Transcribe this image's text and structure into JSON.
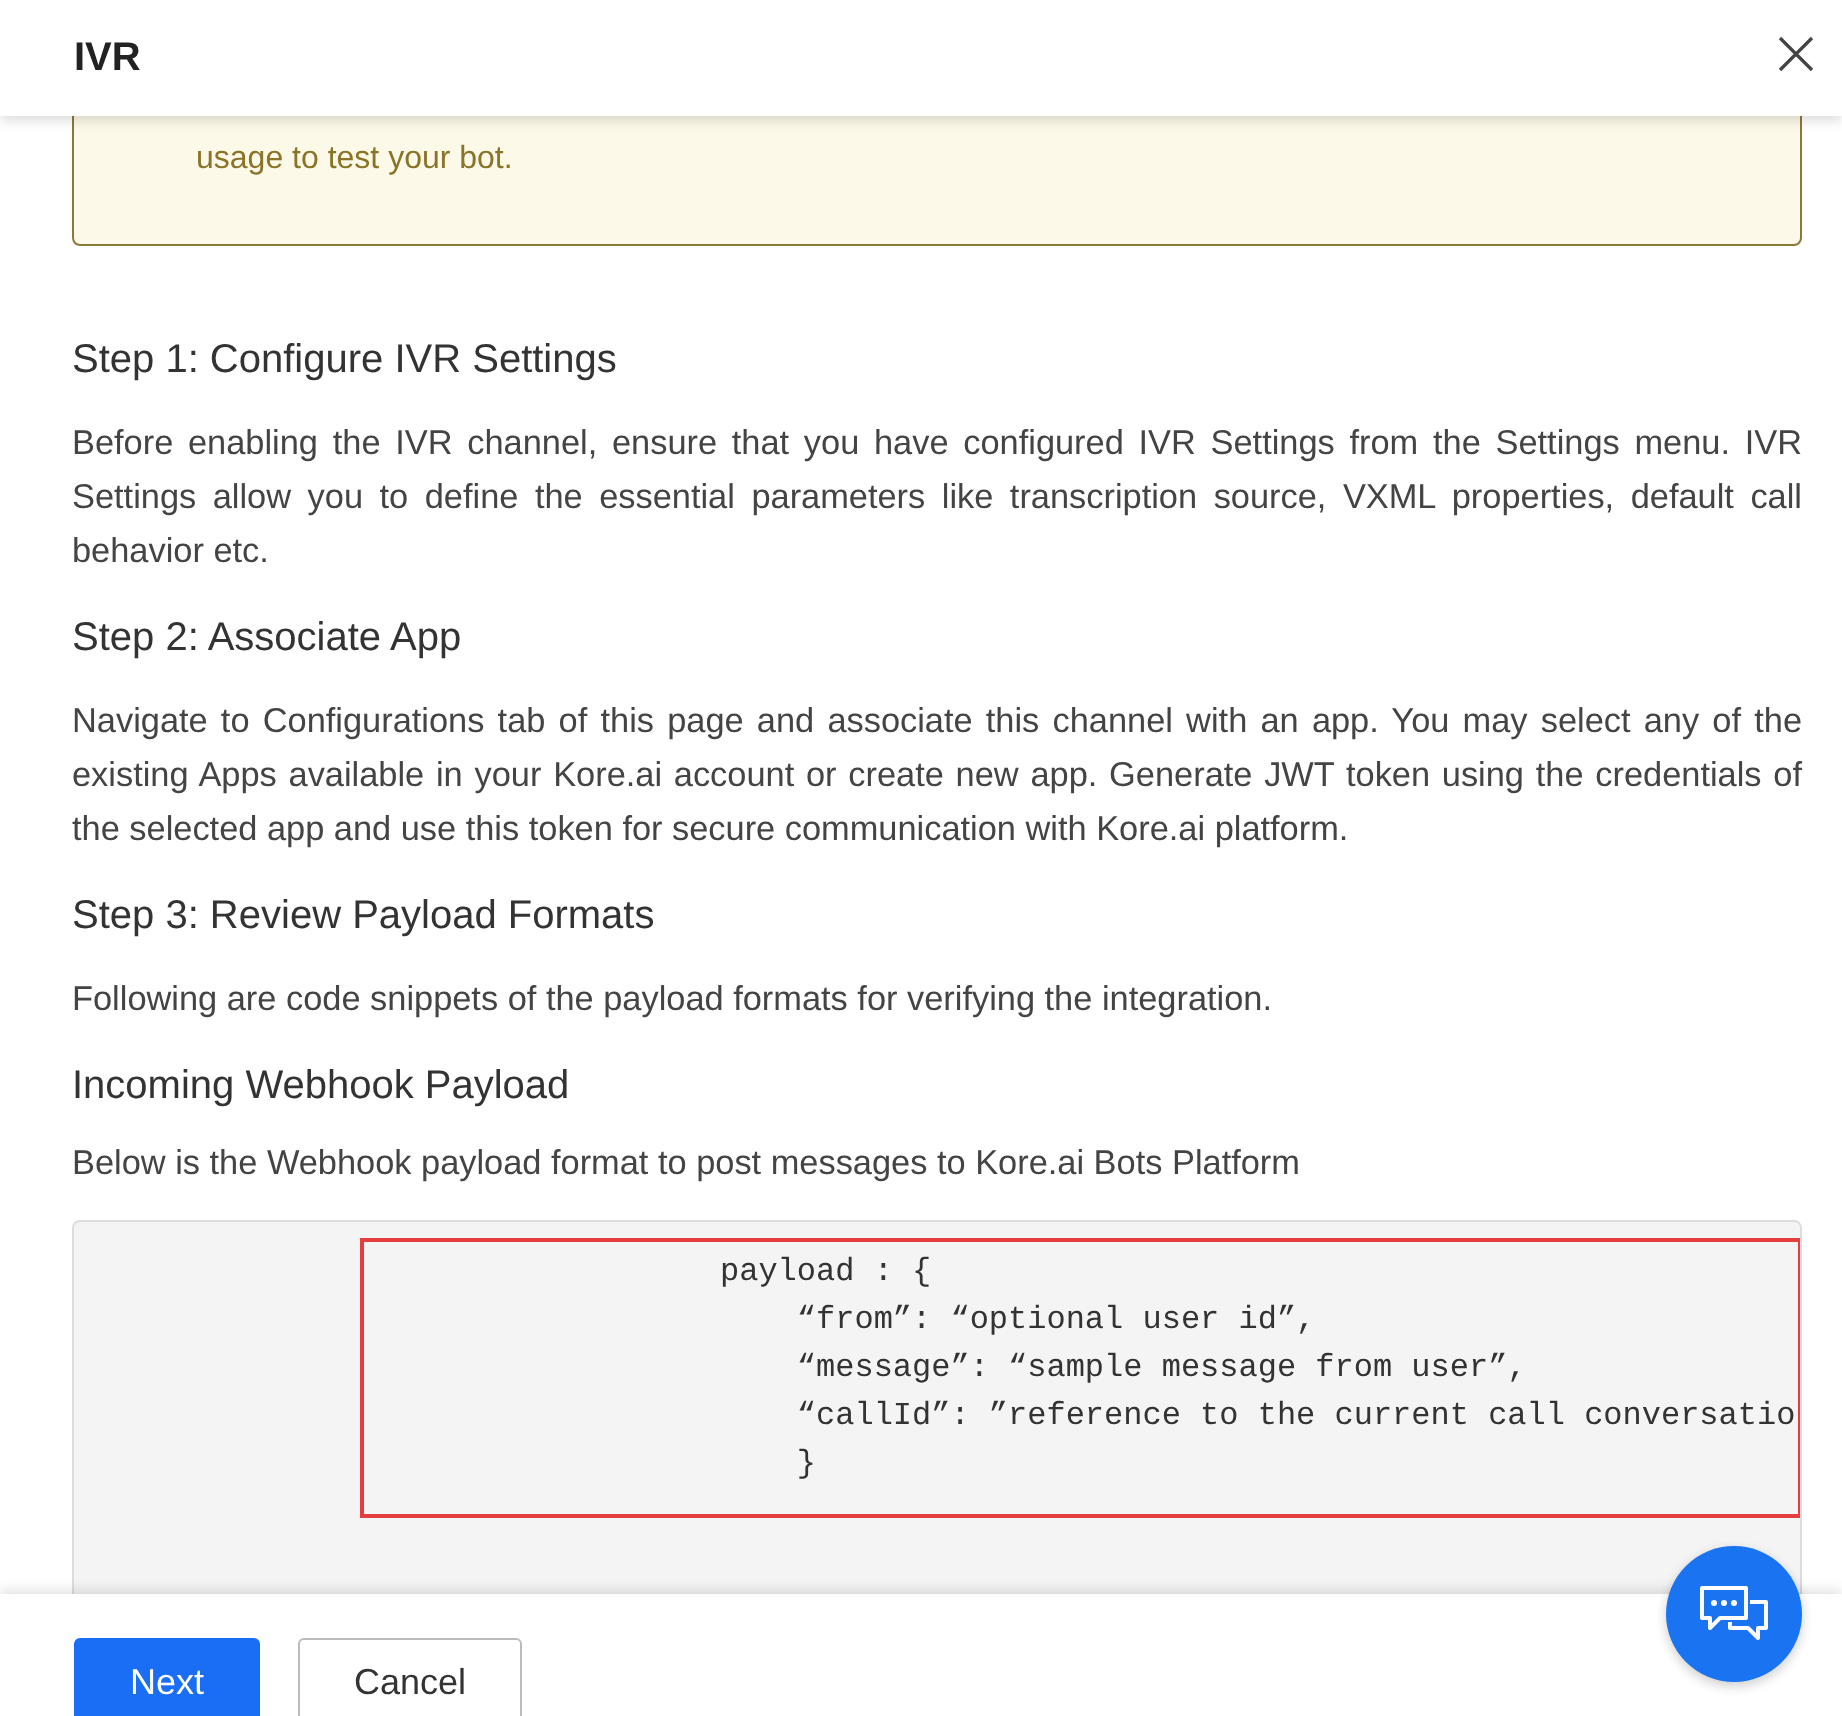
{
  "dialog": {
    "title": "IVR"
  },
  "notice": {
    "lines": [
      "usage to test your bot."
    ]
  },
  "sections": [
    {
      "heading": "Step 1: Configure IVR Settings",
      "text": "Before enabling the IVR channel, ensure that you have configured IVR Settings from the Settings menu. IVR Settings allow you to define the essential parameters like transcription source, VXML properties, default call behavior etc."
    },
    {
      "heading": "Step 2: Associate App",
      "text": "Navigate to Configurations tab of this page and associate this channel with an app. You may select any of the existing Apps available in your Kore.ai account or create new app. Generate JWT token using the credentials of the selected app and use this token for secure communication with Kore.ai platform."
    },
    {
      "heading": "Step 3: Review Payload Formats",
      "text": "Following are code snippets of the payload formats for verifying the integration."
    },
    {
      "heading": "Incoming Webhook Payload",
      "text": "Below is the Webhook payload format to post messages to Kore.ai Bots Platform"
    }
  ],
  "code": {
    "lines": [
      "payload : {",
      "    “from”: “optional user id”,",
      "    “message”: “sample message from user”,",
      "    “callId”: ”reference to the current call conversatio",
      "    }"
    ],
    "highlighted": true
  },
  "buttons": [
    {
      "label": "Next",
      "kind": "primary"
    },
    {
      "label": "Cancel",
      "kind": "secondary"
    }
  ]
}
